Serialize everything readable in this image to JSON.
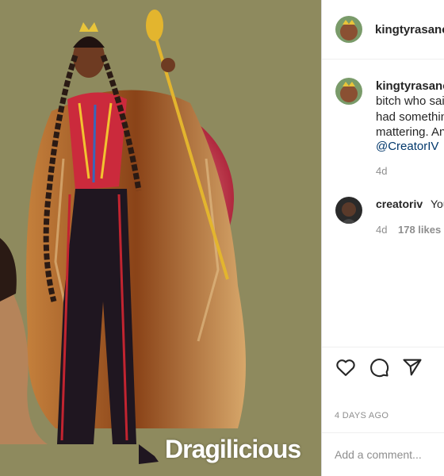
{
  "post": {
    "watermark": "Dragilicious",
    "username": "kingtyrasanc",
    "caption_lines": [
      "bitch who sai",
      "had somethin",
      "mattering. An"
    ],
    "caption_mention": "@CreatorIV",
    "caption_age": "4d"
  },
  "comment": {
    "username": "creatoriv",
    "text": "You",
    "age": "4d",
    "likes": "178 likes"
  },
  "actions": {
    "date": "4 DAYS AGO",
    "add_comment_placeholder": "Add a comment..."
  },
  "colors": {
    "background_art": "#8e8a5e",
    "accent_link": "#00376b",
    "muted": "#8e8e8e"
  }
}
